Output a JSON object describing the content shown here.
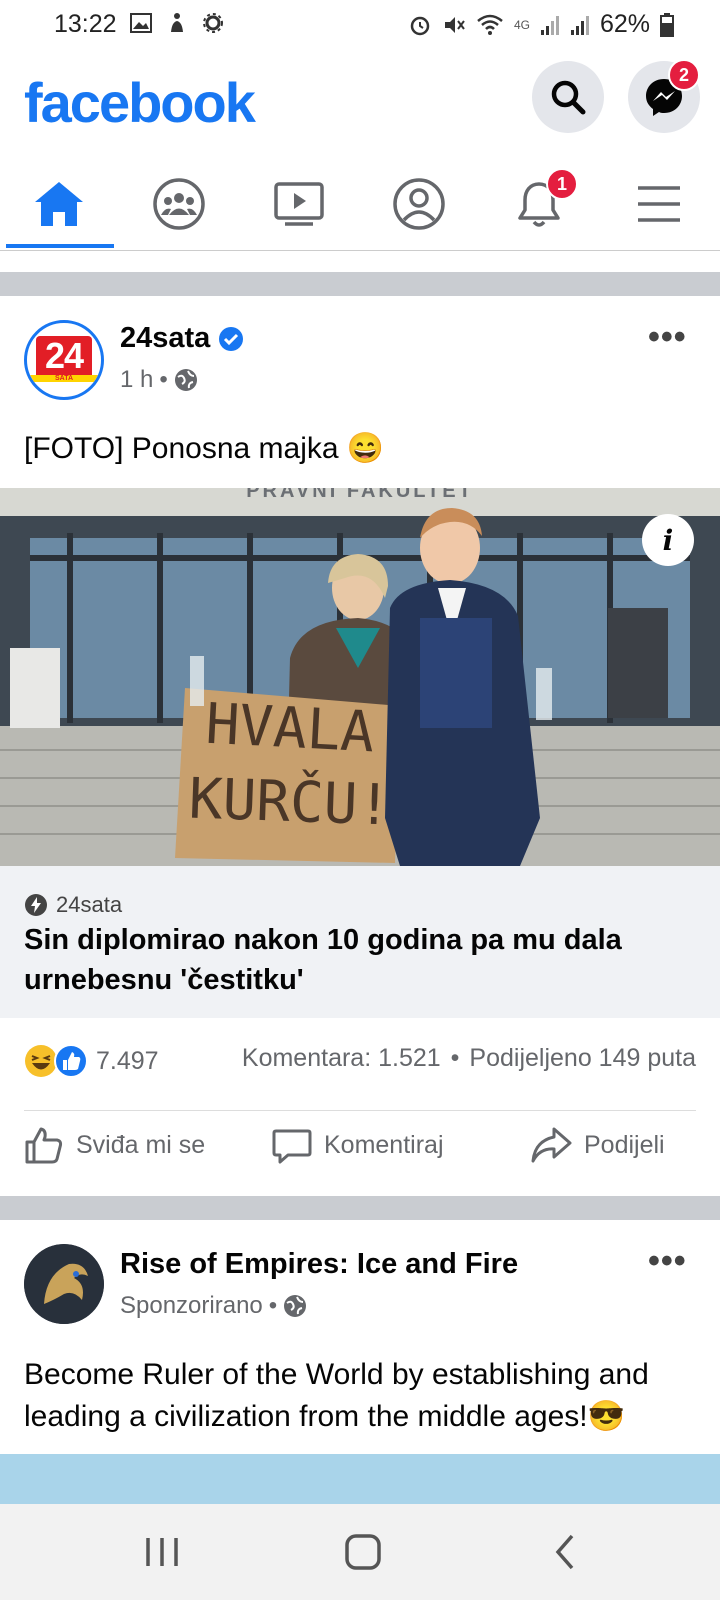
{
  "status_bar": {
    "time": "13:22",
    "battery": "62%",
    "network": "4G"
  },
  "header": {
    "logo": "facebook",
    "messenger_badge": "2"
  },
  "nav": {
    "notifications_badge": "1",
    "active_tab": "home"
  },
  "post1": {
    "page_name": "24sata",
    "avatar_text": "24",
    "avatar_sub": "SATA",
    "time": "1 h",
    "text": "[FOTO] Ponosna majka 😄",
    "photo_sign_line1": "HVALA",
    "photo_sign_line2": "KURČU!",
    "photo_building_text": "PRAVNI FAKULTET",
    "link_source": "24sata",
    "link_title": "Sin diplomirao nakon 10 godina pa mu dala urnebesnu 'čestitku'",
    "reactions_count": "7.497",
    "comments": "Komentara: 1.521",
    "shares": "Podijeljeno 149 puta",
    "actions": {
      "like": "Sviđa mi se",
      "comment": "Komentiraj",
      "share": "Podijeli"
    }
  },
  "post2": {
    "page_name": "Rise of Empires: Ice and Fire",
    "meta": "Sponzorirano",
    "text": "Become Ruler of the World by establishing and leading a civilization from the middle ages!😎"
  },
  "colors": {
    "brand": "#1877f2",
    "badge": "#e41e3f",
    "separator": "#c9ccd1"
  }
}
